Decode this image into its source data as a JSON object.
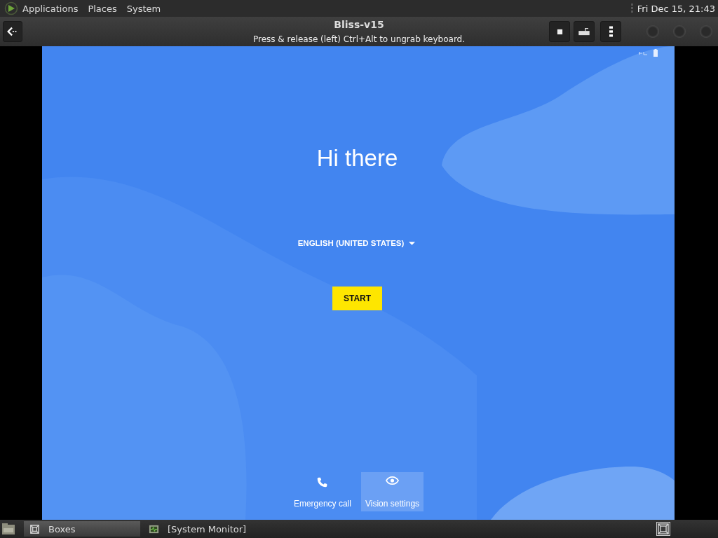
{
  "top_panel": {
    "menus": [
      {
        "label": "Applications"
      },
      {
        "label": "Places"
      },
      {
        "label": "System"
      }
    ],
    "clock": "Fri Dec 15, 21:43"
  },
  "header": {
    "title": "Bliss-v15",
    "subtitle": "Press & release (left) Ctrl+Alt to ungrab keyboard."
  },
  "screen": {
    "greeting": "Hi there",
    "language": "ENGLISH (UNITED STATES)",
    "start_button": "START",
    "actions": [
      {
        "kind": "phone",
        "label": "Emergency call",
        "focused": false
      },
      {
        "kind": "eye",
        "label": "Vision settings",
        "focused": true
      }
    ]
  },
  "taskbar": {
    "tasks": [
      {
        "kind": "boxes",
        "label": "Boxes",
        "selected": true
      },
      {
        "kind": "monitor",
        "label": "[System Monitor]",
        "selected": false
      }
    ]
  }
}
